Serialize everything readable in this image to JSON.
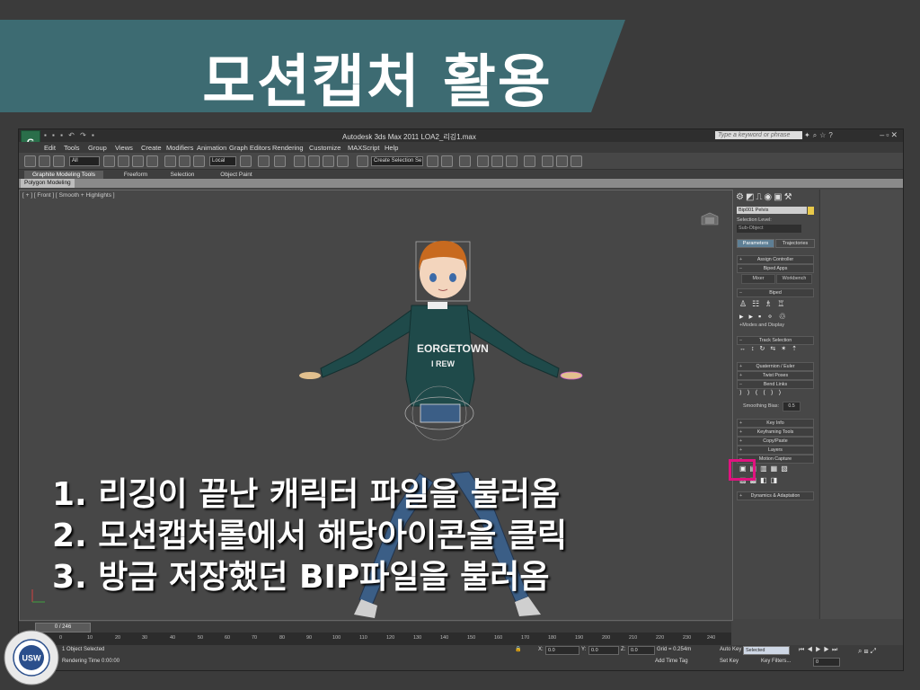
{
  "slide": {
    "title": "모션캡처 활용",
    "instructions": [
      "1.  리깅이 끝난 캐릭터 파일을 불러옴",
      "2.  모션캡처롤에서 해당아이콘을 클릭",
      "3.  방금 저장했던 BIP파일을 불러옴"
    ],
    "colors": {
      "title_band": "#3d6b72",
      "highlight": "#e0137f",
      "background": "#3b3b3b"
    }
  },
  "app": {
    "logo": "G",
    "window_title": "Autodesk 3ds Max  2011      LOA2_리깅1.max",
    "search_placeholder": "Type a keyword or phrase",
    "menu": [
      "Edit",
      "Tools",
      "Group",
      "Views",
      "Create",
      "Modifiers",
      "Animation",
      "Graph Editors",
      "Rendering",
      "Customize",
      "MAXScript",
      "Help"
    ],
    "toolbar": {
      "filter": "All",
      "ref_coord": "Local",
      "selection_set": "Create Selection Se"
    },
    "ribbon_tabs": [
      "Graphite Modeling Tools",
      "Freeform",
      "Selection",
      "Object Paint"
    ],
    "sub_ribbon": "Polygon Modeling",
    "viewport_label": "[ + ] [ Front ] [ Smooth + Highlights ]",
    "shirt_text": [
      "EORGETOWN",
      "I REW"
    ],
    "command_panel": {
      "object_name": "Bip001 Pelvis",
      "selection_level_label": "Selection Level:",
      "sub_object": "Sub-Object",
      "tabs": [
        "Parameters",
        "Trajectories"
      ],
      "rollouts": {
        "assign_controller": "Assign Controller",
        "biped_apps": "Biped Apps",
        "mixer": "Mixer",
        "workbench": "Workbench",
        "biped": "Biped",
        "modes_display": "+Modes and Display",
        "track_selection": "Track Selection",
        "quaternion": "Quaternion / Euler",
        "twist_poses": "Twist Poses",
        "bend_links": "Bend Links",
        "smoothing_bias_label": "Smoothing Bias:",
        "smoothing_bias_value": "0.5",
        "key_info": "Key Info",
        "keyframing_tools": "Keyframing Tools",
        "copy_paste": "Copy/Paste",
        "layers": "Layers",
        "motion_capture": "Motion Capture",
        "dynamics": "Dynamics & Adaptation"
      }
    },
    "timeline": {
      "frame_display": "0 / 246",
      "ticks": [
        "0",
        "10",
        "20",
        "30",
        "40",
        "50",
        "60",
        "70",
        "80",
        "90",
        "100",
        "110",
        "120",
        "130",
        "140",
        "150",
        "160",
        "170",
        "180",
        "190",
        "200",
        "210",
        "220",
        "230",
        "240"
      ]
    },
    "status": {
      "selected": "1 Object Selected",
      "render_time": "Rendering Time  0:00:00",
      "x_label": "X:",
      "x_value": "0.0",
      "y_label": "Y:",
      "y_value": "0.0",
      "z_label": "Z:",
      "z_value": "0.0",
      "grid": "Grid = 0.254m",
      "add_time_tag": "Add Time Tag",
      "auto_key": "Auto Key",
      "selected_dropdown": "Selected",
      "set_key": "Set Key",
      "key_filters": "Key Filters...",
      "frame_field": "0"
    }
  },
  "logo": {
    "university_text": "THE UNIVERSITY OF SUWON",
    "abbr": "USW"
  }
}
